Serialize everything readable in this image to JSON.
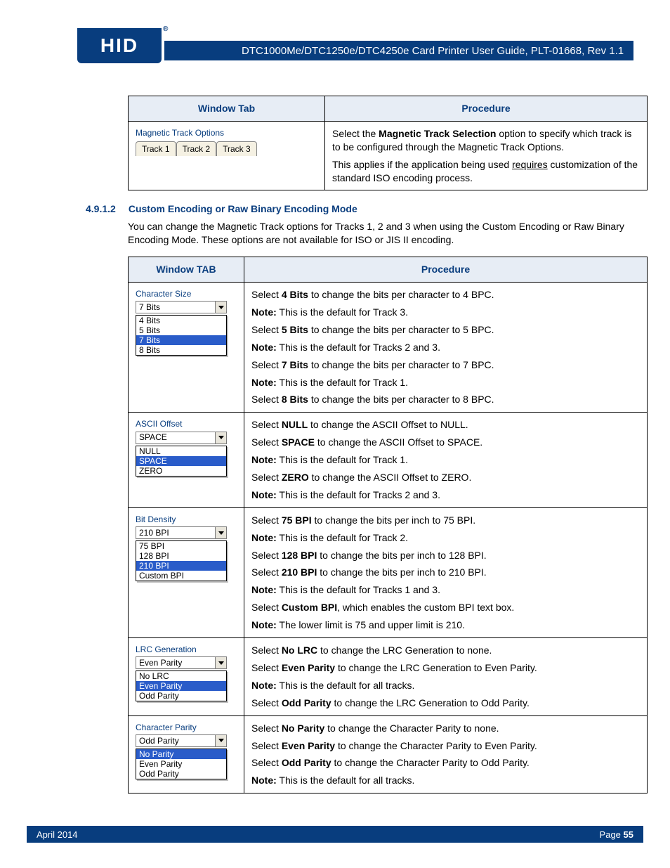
{
  "header": {
    "logo_text": "HID",
    "title": "DTC1000Me/DTC1250e/DTC4250e Card Printer User Guide, PLT-01668, Rev 1.1"
  },
  "table1": {
    "headers": {
      "win": "Window Tab",
      "proc": "Procedure"
    },
    "row": {
      "mag_label": "Magnetic Track Options",
      "tabs": [
        "Track 1",
        "Track 2",
        "Track 3"
      ],
      "p1_pre": "Select the ",
      "p1_b": "Magnetic Track Selection",
      "p1_post": " option to specify which track is to be configured through the Magnetic Track Options.",
      "p2_pre": "This applies if the application being used ",
      "p2_u": "requires",
      "p2_post": " customization of the standard ISO encoding process."
    }
  },
  "section": {
    "num": "4.9.1.2",
    "title": "Custom Encoding or Raw Binary Encoding Mode",
    "para": "You can change the Magnetic Track options for Tracks 1, 2 and 3 when using the Custom Encoding or Raw Binary Encoding Mode. These options are not available for ISO or JIS II encoding."
  },
  "table2": {
    "headers": {
      "win": "Window TAB",
      "proc": "Procedure"
    },
    "rows": [
      {
        "ui": {
          "label": "Character Size",
          "value": "7 Bits",
          "options": [
            {
              "text": "4 Bits",
              "sel": false
            },
            {
              "text": "5 Bits",
              "sel": false
            },
            {
              "text": "7 Bits",
              "sel": true
            },
            {
              "text": "8 Bits",
              "sel": false
            }
          ]
        },
        "lines": [
          {
            "pre": "Select ",
            "b": "4 Bits",
            "post": " to change the bits per character to 4 BPC."
          },
          {
            "b": "Note:",
            "post": " This is the default for Track 3."
          },
          {
            "pre": "Select ",
            "b": "5 Bits",
            "post": " to change the bits per character to 5 BPC."
          },
          {
            "b": "Note:",
            "post": " This is the default for Tracks 2 and 3."
          },
          {
            "pre": "Select ",
            "b": "7 Bits",
            "post": " to change the bits per character to 7 BPC."
          },
          {
            "b": "Note:",
            "post": " This is the default for Track 1."
          },
          {
            "pre": "Select ",
            "b": "8 Bits",
            "post": " to change the bits per character to 8 BPC."
          }
        ]
      },
      {
        "ui": {
          "label": "ASCII Offset",
          "value": "SPACE",
          "options": [
            {
              "text": "NULL",
              "sel": false
            },
            {
              "text": "SPACE",
              "sel": true
            },
            {
              "text": "ZERO",
              "sel": false
            }
          ]
        },
        "lines": [
          {
            "pre": "Select ",
            "b": "NULL",
            "post": " to change the ASCII Offset to NULL."
          },
          {
            "pre": "Select ",
            "b": "SPACE",
            "post": " to change the ASCII Offset to SPACE."
          },
          {
            "b": "Note:",
            "post": " This is the default for Track 1."
          },
          {
            "pre": "Select ",
            "b": "ZERO",
            "post": " to change the ASCII Offset to ZERO."
          },
          {
            "b": "Note:",
            "post": " This is the default for Tracks 2 and 3."
          }
        ]
      },
      {
        "ui": {
          "label": "Bit Density",
          "value": "210 BPI",
          "options": [
            {
              "text": "75 BPI",
              "sel": false
            },
            {
              "text": "128 BPI",
              "sel": false
            },
            {
              "text": "210 BPI",
              "sel": true
            },
            {
              "text": "Custom BPI",
              "sel": false
            }
          ]
        },
        "lines": [
          {
            "pre": "Select ",
            "b": "75 BPI",
            "post": " to change the bits per inch to 75 BPI."
          },
          {
            "b": "Note:",
            "post": " This is the default for Track 2."
          },
          {
            "pre": "Select ",
            "b": "128 BPI",
            "post": " to change the bits per inch to 128 BPI."
          },
          {
            "pre": "Select ",
            "b": "210 BPI",
            "post": " to change the bits per inch to 210 BPI."
          },
          {
            "b": "Note:",
            "post": " This is the default for Tracks 1 and 3."
          },
          {
            "pre": "Select ",
            "b": "Custom BPI",
            "post": ", which enables the custom BPI text box."
          },
          {
            "b": "Note:",
            "post": " The lower limit is 75 and upper limit is 210."
          }
        ]
      },
      {
        "ui": {
          "label": "LRC Generation",
          "value": "Even Parity",
          "options": [
            {
              "text": "No LRC",
              "sel": false
            },
            {
              "text": "Even Parity",
              "sel": true
            },
            {
              "text": "Odd Parity",
              "sel": false
            }
          ]
        },
        "lines": [
          {
            "pre": "Select ",
            "b": "No LRC",
            "post": " to change the LRC Generation to none."
          },
          {
            "pre": "Select ",
            "b": "Even Parity",
            "post": " to change the LRC Generation to Even Parity."
          },
          {
            "b": "Note:",
            "post": " This is the default for all tracks."
          },
          {
            "pre": "Select ",
            "b": "Odd Parity",
            "post": " to change the LRC Generation to Odd Parity."
          }
        ]
      },
      {
        "ui": {
          "label": "Character Parity",
          "value": "Odd Parity",
          "options": [
            {
              "text": "No Parity",
              "sel": true
            },
            {
              "text": "Even Parity",
              "sel": false
            },
            {
              "text": "Odd Parity",
              "sel": false
            }
          ]
        },
        "lines": [
          {
            "pre": "Select ",
            "b": "No Parity",
            "post": " to change the Character Parity to none."
          },
          {
            "pre": "Select ",
            "b": "Even Parity",
            "post": " to change the Character Parity to Even Parity."
          },
          {
            "pre": "Select ",
            "b": "Odd Parity",
            "post": " to change the Character Parity to Odd Parity."
          },
          {
            "b": "Note:",
            "post": " This is the default for all tracks."
          }
        ]
      }
    ]
  },
  "footer": {
    "left": "April 2014",
    "right_label": "Page ",
    "right_num": "55"
  }
}
